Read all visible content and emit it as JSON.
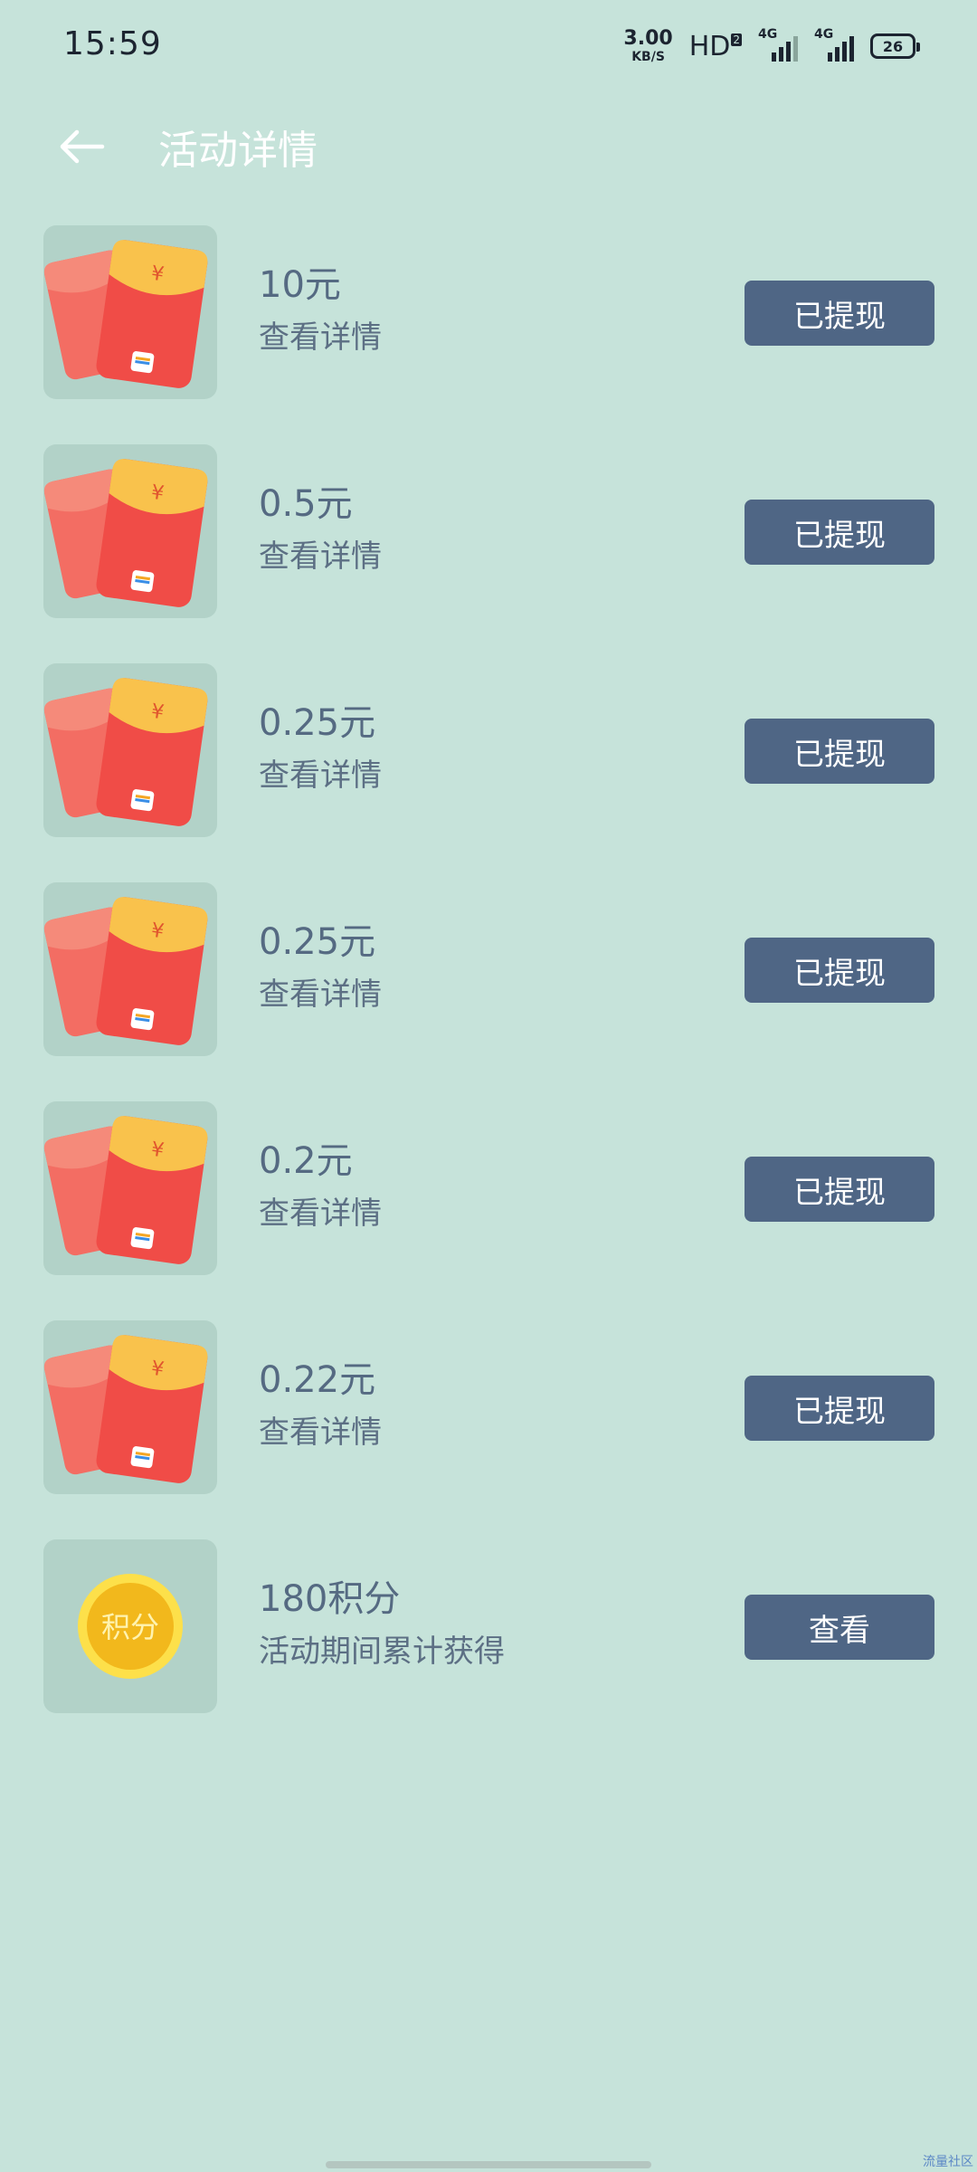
{
  "status_bar": {
    "time": "15:59",
    "net_speed_value": "3.00",
    "net_speed_unit": "KB/S",
    "hd_label": "HD",
    "hd_sub": "2",
    "sim1_tag": "4G",
    "sim2_tag": "4G",
    "battery_level": "26"
  },
  "header": {
    "back_icon": "arrow-left-icon",
    "title": "活动详情"
  },
  "items": [
    {
      "icon": "red-envelope-icon",
      "title": "10元",
      "subtitle": "查看详情",
      "button": "已提现"
    },
    {
      "icon": "red-envelope-icon",
      "title": "0.5元",
      "subtitle": "查看详情",
      "button": "已提现"
    },
    {
      "icon": "red-envelope-icon",
      "title": "0.25元",
      "subtitle": "查看详情",
      "button": "已提现"
    },
    {
      "icon": "red-envelope-icon",
      "title": "0.25元",
      "subtitle": "查看详情",
      "button": "已提现"
    },
    {
      "icon": "red-envelope-icon",
      "title": "0.2元",
      "subtitle": "查看详情",
      "button": "已提现"
    },
    {
      "icon": "red-envelope-icon",
      "title": "0.22元",
      "subtitle": "查看详情",
      "button": "已提现"
    },
    {
      "icon": "points-coin-icon",
      "title": "180积分",
      "subtitle": "活动期间累计获得",
      "button": "查看",
      "coin_label": "积分"
    }
  ],
  "watermark": "流量社区",
  "colors": {
    "background": "#c6e3da",
    "button": "#4f6685",
    "envelope_red": "#f04c47",
    "envelope_flap": "#f9c24c",
    "coin_gold": "#f2b81c"
  }
}
